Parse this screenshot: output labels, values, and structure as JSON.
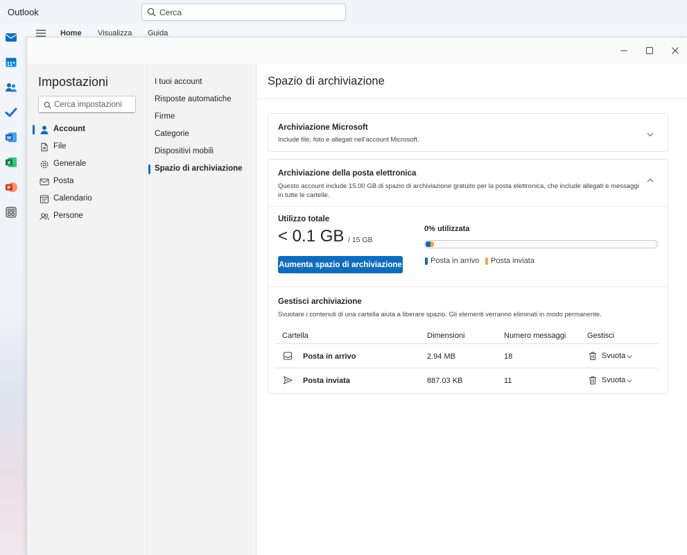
{
  "app": {
    "title": "Outlook"
  },
  "search": {
    "placeholder": "Cerca"
  },
  "ribbon": {
    "tabs": [
      "Home",
      "Visualizza",
      "Guida"
    ]
  },
  "rail": {
    "icons": [
      "mail-icon",
      "calendar-icon",
      "people-icon",
      "todo-icon",
      "word-icon",
      "excel-icon",
      "powerpoint-icon",
      "apps-icon"
    ]
  },
  "settings": {
    "title": "Impostazioni",
    "search_placeholder": "Cerca impostazioni",
    "categories": [
      {
        "label": "Account",
        "icon": "person-icon",
        "active": true
      },
      {
        "label": "File",
        "icon": "file-icon",
        "active": false
      },
      {
        "label": "Generale",
        "icon": "gear-icon",
        "active": false
      },
      {
        "label": "Posta",
        "icon": "mail-icon",
        "active": false
      },
      {
        "label": "Calendario",
        "icon": "calendar-icon",
        "active": false
      },
      {
        "label": "Persone",
        "icon": "people-icon",
        "active": false
      }
    ],
    "subitems": [
      {
        "label": "I tuoi account",
        "active": false
      },
      {
        "label": "Risposte automatiche",
        "active": false
      },
      {
        "label": "Firme",
        "active": false
      },
      {
        "label": "Categorie",
        "active": false
      },
      {
        "label": "Dispositivi mobili",
        "active": false
      },
      {
        "label": "Spazio di archiviazione",
        "active": true
      }
    ]
  },
  "page": {
    "title": "Spazio di archiviazione",
    "microsoft_storage": {
      "heading": "Archiviazione Microsoft",
      "description": "Include file, foto e allegati nell'account Microsoft."
    },
    "mail_storage": {
      "heading": "Archiviazione della posta elettronica",
      "description": "Questo account include 15.00 GB di spazio di archiviazione gratuito per la posta elettronica, che include allegati e messaggi in tutte le cartelle.",
      "total_label": "Utilizzo totale",
      "used": "< 0.1 GB",
      "total": "/ 15 GB",
      "percent_label": "0% utilizzata",
      "increase_button": "Aumenta spazio di archiviazione",
      "usage_fraction": {
        "inbox": 0.02,
        "sent": 0.015
      },
      "legend": [
        {
          "label": "Posta in arrivo",
          "color": "#0f6cbd"
        },
        {
          "label": "Posta inviata",
          "color": "#f7a83c"
        }
      ]
    },
    "manage": {
      "heading": "Gestisci archiviazione",
      "description": "Svuotare i contenuti di una cartella aiuta a liberare spazio. Gli elementi verranno eliminati in modo permanente.",
      "columns": [
        "Cartella",
        "Dimensioni",
        "Numero messaggi",
        "Gestisci"
      ],
      "rows": [
        {
          "folder": "Posta in arrivo",
          "icon": "inbox-icon",
          "size": "2.94 MB",
          "count": "18",
          "action": "Svuota"
        },
        {
          "folder": "Posta inviata",
          "icon": "send-icon",
          "size": "887.03 KB",
          "count": "11",
          "action": "Svuota"
        }
      ]
    }
  }
}
